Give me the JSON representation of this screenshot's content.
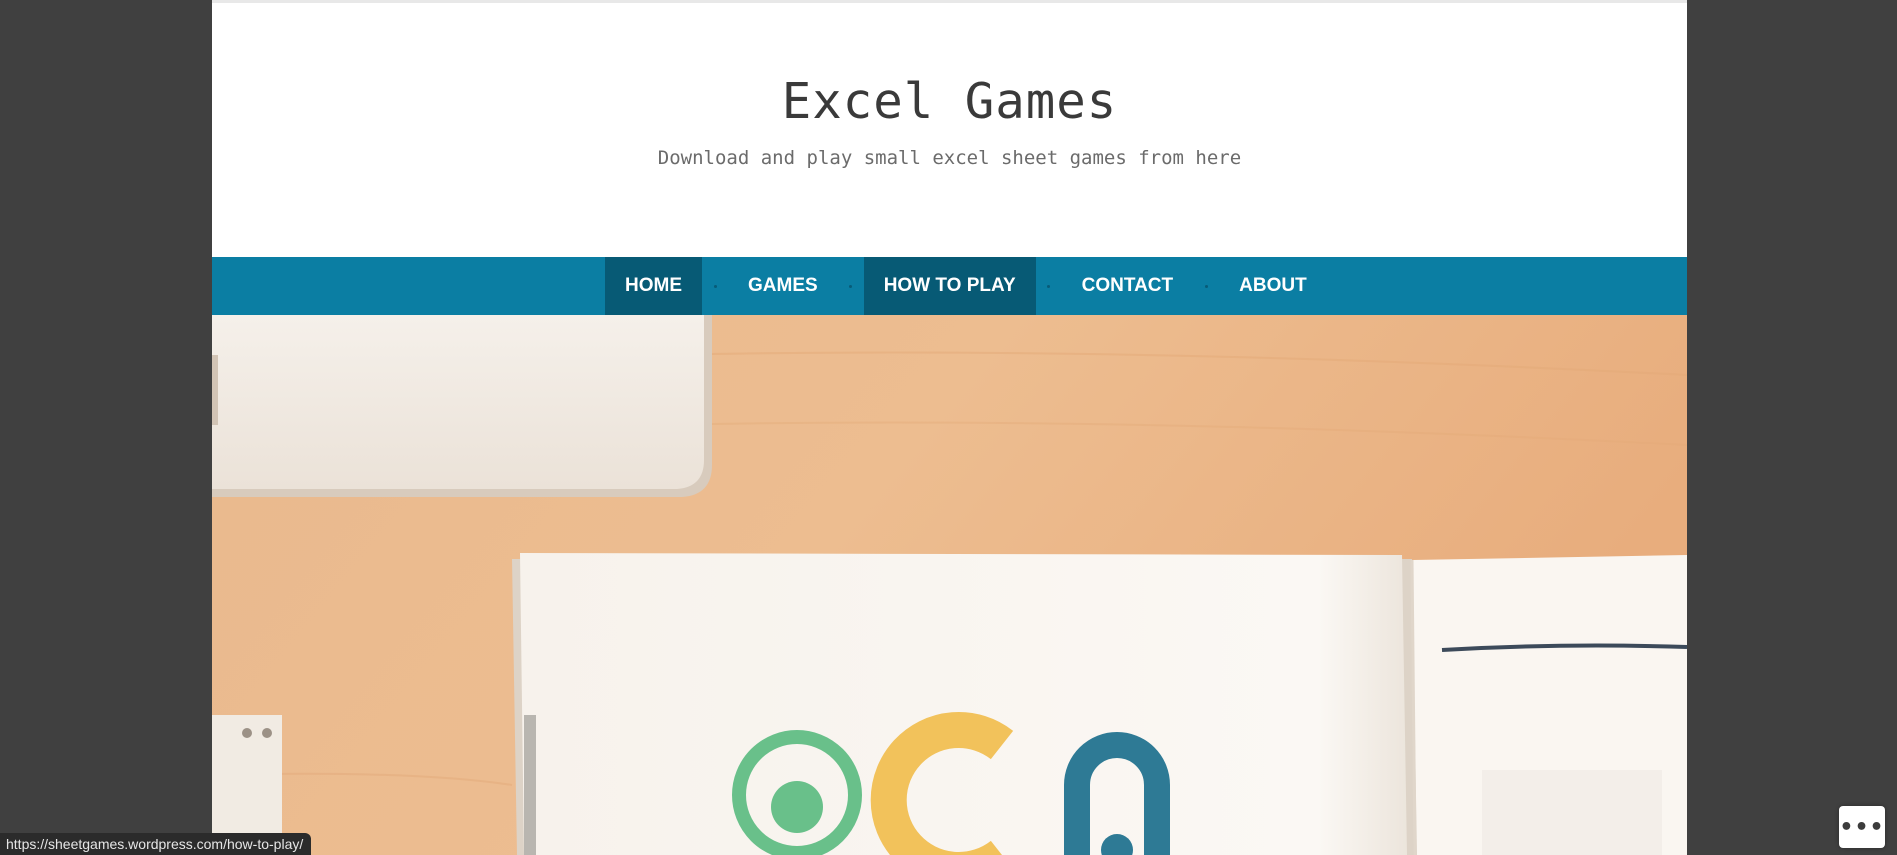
{
  "site": {
    "title": "Excel Games",
    "tagline": "Download and play small excel sheet games from here"
  },
  "nav": {
    "items": [
      {
        "label": "HOME",
        "active": true
      },
      {
        "label": "GAMES",
        "active": false
      },
      {
        "label": "HOW TO PLAY",
        "active": true
      },
      {
        "label": "CONTACT",
        "active": false
      },
      {
        "label": "ABOUT",
        "active": false
      }
    ]
  },
  "status_bar": {
    "url": "https://sheetgames.wordpress.com/how-to-play/"
  },
  "floating": {
    "more_label": "•••",
    "more_icon": "ellipsis-icon"
  },
  "colors": {
    "nav_bg": "#0b7ea3",
    "nav_active": "#075a75",
    "page_outer": "#404040"
  }
}
